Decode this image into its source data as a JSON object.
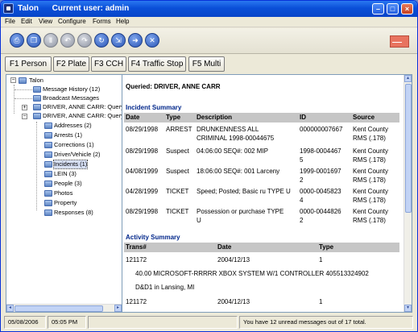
{
  "window": {
    "app": "Talon",
    "user_prefix": "Current user:",
    "user": "admin"
  },
  "menu": [
    "File",
    "Edit",
    "View",
    "Configure",
    "Forms",
    "Help"
  ],
  "toolbar_icons": [
    "print-icon",
    "copy-icon",
    "pause-icon",
    "undo-icon",
    "redo-icon",
    "refresh-icon",
    "export-icon",
    "forward-icon",
    "close-circle-icon"
  ],
  "fkeys": [
    "F1 Person",
    "F2 Plate",
    "F3 CCH",
    "F4 Traffic Stop",
    "F5 Multi"
  ],
  "tree": {
    "root": "Talon",
    "items": [
      "Message History (12)",
      "Broadcast Messages",
      "DRIVER, ANNE CARR: Query",
      "DRIVER, ANNE CARR: Query"
    ],
    "children": [
      "Addresses (2)",
      "Arrests (1)",
      "Corrections (1)",
      "Driver/Vehicle (2)",
      "Incidents (1)",
      "LEIN (3)",
      "People (3)",
      "Photos",
      "Property",
      "Responses (8)"
    ]
  },
  "content": {
    "queried": "Queried: DRIVER, ANNE CARR",
    "incident_title": "Incident Summary",
    "incident_cols": [
      "Date",
      "Type",
      "Description",
      "ID",
      "Source"
    ],
    "incidents": [
      {
        "date": "08/29/1998",
        "type": "ARREST",
        "desc1": "DRUNKENNESS ALL",
        "desc2": "CRIMINAL 1998-00044675",
        "id1": "000000007667",
        "id2": "",
        "src1": "Kent County",
        "src2": "RMS (.178)"
      },
      {
        "date": "08/29/1998",
        "type": "Suspect",
        "desc1": "04:06:00 SEQ#: 002 MIP",
        "desc2": "",
        "id1": "1998-0004467",
        "id2": "5",
        "src1": "Kent County",
        "src2": "RMS (.178)"
      },
      {
        "date": "04/08/1999",
        "type": "Suspect",
        "desc1": "18:06:00 SEQ#: 001 Larceny",
        "desc2": "",
        "id1": "1999-0001697",
        "id2": "2",
        "src1": "Kent County",
        "src2": "RMS (.178)"
      },
      {
        "date": "04/28/1999",
        "type": "TICKET",
        "desc1": "Speed; Posted; Basic ru TYPE U",
        "desc2": "",
        "id1": "0000-0045823",
        "id2": "4",
        "src1": "Kent County",
        "src2": "RMS (.178)"
      },
      {
        "date": "08/29/1998",
        "type": "TICKET",
        "desc1": "Possession or purchase TYPE",
        "desc2": "U",
        "id1": "0000-0044826",
        "id2": "2",
        "src1": "Kent County",
        "src2": "RMS (.178)"
      }
    ],
    "activity_title": "Activity Summary",
    "activity_cols": [
      "Trans#",
      "Date",
      "Type"
    ],
    "activity": [
      {
        "trans": "121172",
        "date": "2004/12/13",
        "type": "1"
      },
      {
        "trans": "121172",
        "date": "2004/12/13",
        "type": "1"
      }
    ],
    "activity_detail1": "40.00 MICROSOFT-RRRRR XBOX SYSTEM W/1 CONTROLLER 405513324902",
    "activity_detail2": "D&D1 in Lansing, MI"
  },
  "status": {
    "date": "05/08/2006",
    "time": "05:05 PM",
    "blank": "",
    "messages": "You have 12 unread messages out of 17 total."
  }
}
